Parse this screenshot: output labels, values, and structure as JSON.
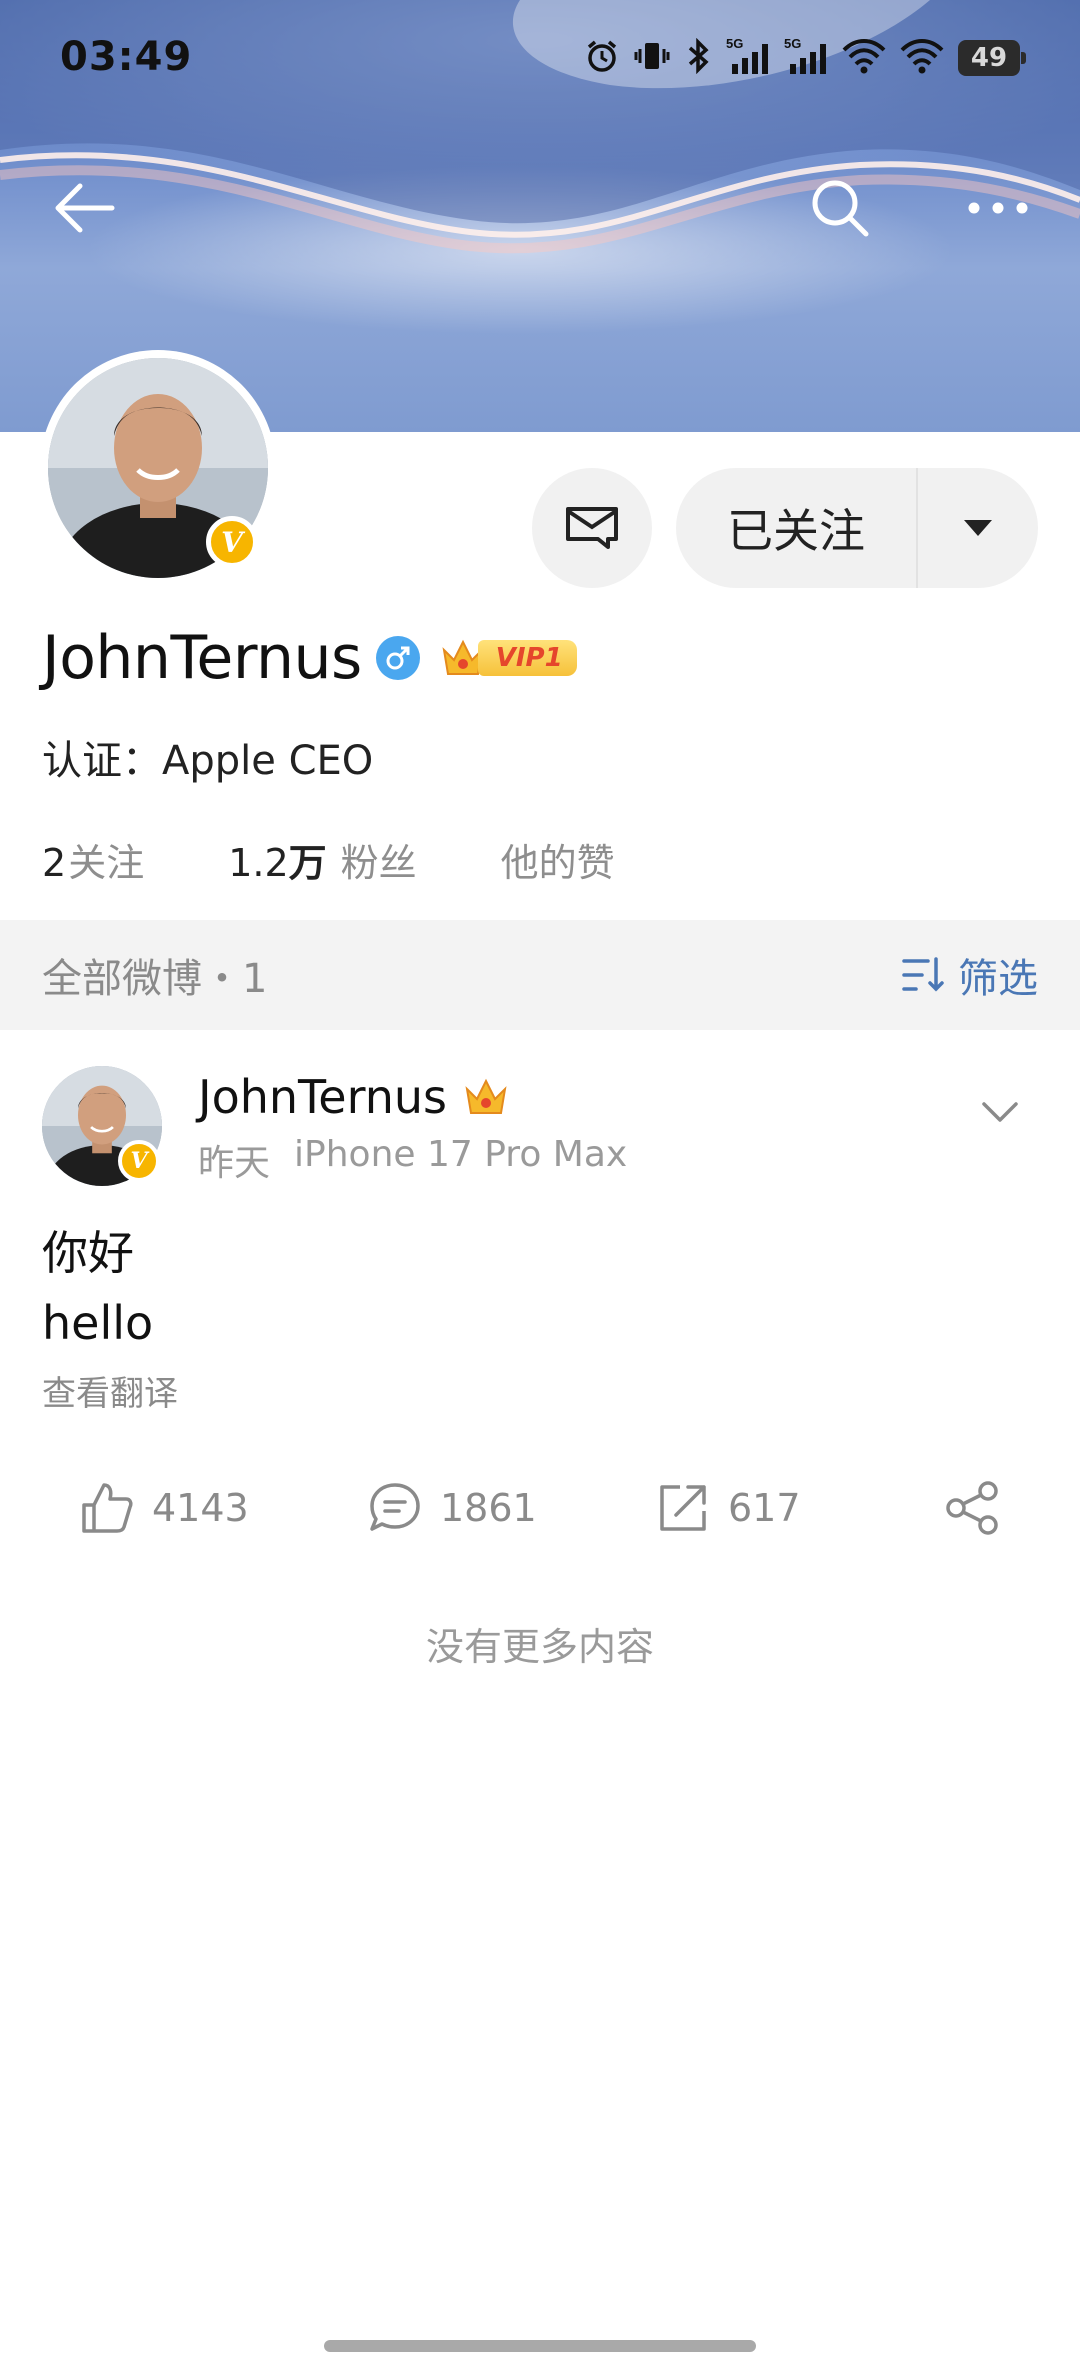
{
  "status_bar": {
    "time": "03:49",
    "signal_labels": [
      "5G",
      "5G"
    ],
    "battery": "49",
    "icons": [
      "alarm-icon",
      "vibrate-icon",
      "bluetooth-icon",
      "signal-icon",
      "signal-icon",
      "wifi-icon",
      "wifi-icon",
      "battery-icon"
    ]
  },
  "top_nav": {
    "back_icon": "back-arrow-icon",
    "search_icon": "search-icon",
    "more_icon": "more-icon"
  },
  "profile": {
    "name": "JohnTernus",
    "verified_badge": "V",
    "gender_icon": "male-icon",
    "vip_label": "VIP1",
    "certification": "认证：Apple CEO",
    "message_icon": "message-icon",
    "follow_label": "已关注",
    "follow_dropdown_icon": "caret-down-icon",
    "stats": {
      "following_count": "2",
      "following_label": "关注",
      "followers_count": "1.2",
      "followers_unit": "万",
      "followers_label": "粉丝",
      "likes_label": "他的赞"
    }
  },
  "feed_header": {
    "title": "全部微博・1",
    "filter_label": "筛选",
    "filter_icon": "filter-icon"
  },
  "post": {
    "author": "JohnTernus",
    "verified_badge": "V",
    "time": "昨天",
    "device": "iPhone 17 Pro Max",
    "text_line1": "你好",
    "text_line2": "hello",
    "translate_label": "查看翻译",
    "actions": {
      "likes": "4143",
      "comments": "1861",
      "reposts": "617"
    }
  },
  "end_note": "没有更多内容",
  "colors": {
    "accent_blue": "#4a77b5",
    "verified_gold": "#f7b500",
    "gender_blue": "#4aa7ef",
    "vip_red": "#e5462c"
  }
}
